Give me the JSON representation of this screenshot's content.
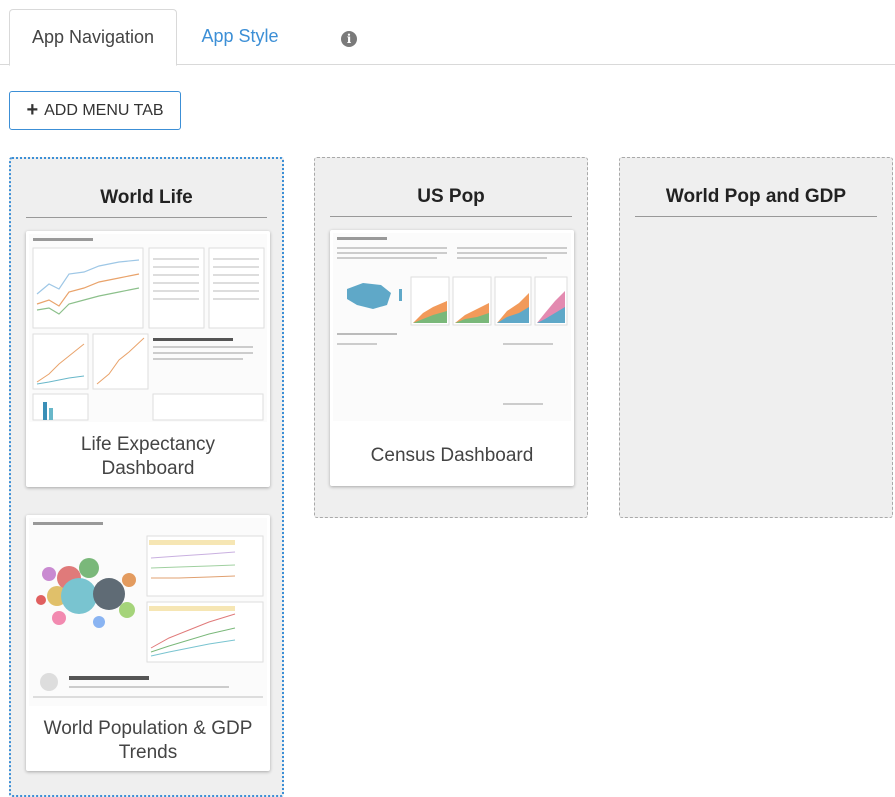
{
  "tabs": [
    {
      "label": "App Navigation"
    },
    {
      "label": "App Style"
    }
  ],
  "info_icon": "info-circle-icon",
  "add_button": {
    "label": "ADD MENU TAB",
    "icon": "plus-icon"
  },
  "columns": [
    {
      "title": "World Life",
      "cards": [
        {
          "label": "Life Expectancy Dashboard"
        },
        {
          "label": "World Population & GDP Trends"
        }
      ]
    },
    {
      "title": "US Pop",
      "cards": [
        {
          "label": "Census Dashboard"
        }
      ]
    },
    {
      "title": "World Pop and GDP",
      "cards": []
    }
  ],
  "colors": {
    "accent": "#3c8fd6",
    "column_bg": "#efefef"
  }
}
